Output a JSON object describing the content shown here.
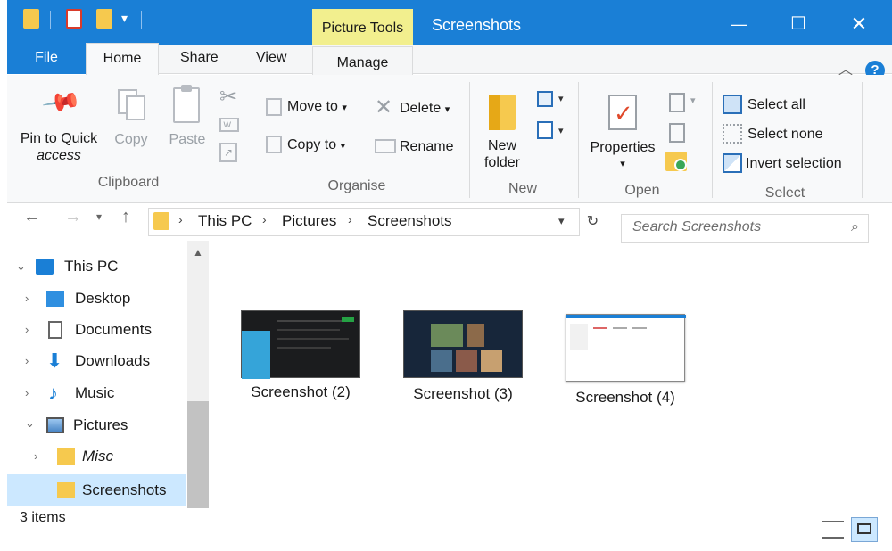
{
  "title_bar": {
    "context_tab": "Picture Tools",
    "window_title": "Screenshots",
    "minimize": "—",
    "maximize": "☐",
    "close": "✕"
  },
  "tabs": {
    "file": "File",
    "home": "Home",
    "share": "Share",
    "view": "View",
    "manage": "Manage"
  },
  "ribbon": {
    "clipboard": {
      "label": "Clipboard",
      "pin_line1": "Pin to Quick",
      "pin_line2": "access",
      "copy": "Copy",
      "paste": "Paste"
    },
    "organise": {
      "label": "Organise",
      "move_to": "Move to",
      "copy_to": "Copy to",
      "delete": "Delete",
      "rename": "Rename"
    },
    "new": {
      "label": "New",
      "new_folder_line1": "New",
      "new_folder_line2": "folder"
    },
    "open": {
      "label": "Open",
      "properties": "Properties"
    },
    "select": {
      "label": "Select",
      "select_all": "Select all",
      "select_none": "Select none",
      "invert_selection": "Invert selection"
    }
  },
  "address": {
    "crumbs": [
      "This PC",
      "Pictures",
      "Screenshots"
    ],
    "search_placeholder": "Search Screenshots"
  },
  "nav": {
    "items": [
      {
        "label": "This PC",
        "icon": "monitor-icon"
      },
      {
        "label": "Desktop",
        "icon": "desktop-icon"
      },
      {
        "label": "Documents",
        "icon": "document-icon"
      },
      {
        "label": "Downloads",
        "icon": "download-arrow-icon"
      },
      {
        "label": "Music",
        "icon": "music-note-icon"
      },
      {
        "label": "Pictures",
        "icon": "pictures-icon"
      },
      {
        "label": "Misc",
        "icon": "folder-icon"
      },
      {
        "label": "Screenshots",
        "icon": "folder-icon"
      }
    ]
  },
  "files": [
    {
      "name": "Screenshot (2)"
    },
    {
      "name": "Screenshot (3)"
    },
    {
      "name": "Screenshot (4)"
    }
  ],
  "status": {
    "item_count": "3 items"
  },
  "colors": {
    "accent": "#1a7fd6",
    "context_tab": "#f2ef8e",
    "selection": "#cce8ff"
  }
}
